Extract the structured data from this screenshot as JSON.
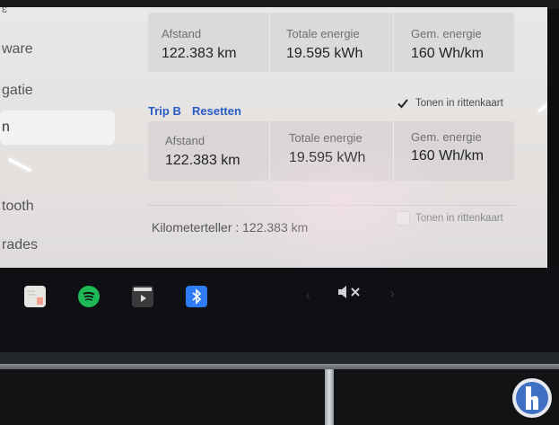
{
  "sidebar": {
    "items": [
      "ware",
      "gatie",
      "n",
      "tooth",
      "rades"
    ]
  },
  "trip_a": {
    "cells": [
      {
        "label": "Afstand",
        "value": "122.383 km"
      },
      {
        "label": "Totale energie",
        "value": "19.595 kWh"
      },
      {
        "label": "Gem. energie",
        "value": "160 Wh/km"
      }
    ]
  },
  "trip_b": {
    "name": "Trip B",
    "reset_label": "Resetten",
    "show_label": "Tonen in rittenkaart",
    "show_checked": true,
    "cells": [
      {
        "label": "Afstand",
        "value": "122.383 km"
      },
      {
        "label": "Totale energie",
        "value": "19.595 kWh"
      },
      {
        "label": "Gem. energie",
        "value": "160 Wh/km"
      }
    ]
  },
  "odometer": {
    "text": "Kilometerteller : 122.383 km",
    "show_label": "Tonen in rittenkaart",
    "show_checked": false
  },
  "taskbar": {
    "icons": [
      "notes-icon",
      "spotify-icon",
      "media-player-icon",
      "bluetooth-icon",
      "prev-chevron-icon",
      "volume-muted-icon",
      "next-chevron-icon"
    ],
    "colors": {
      "spotify": "#1db954",
      "bluetooth": "#2d7cf6",
      "link": "#2a5cc6"
    }
  }
}
